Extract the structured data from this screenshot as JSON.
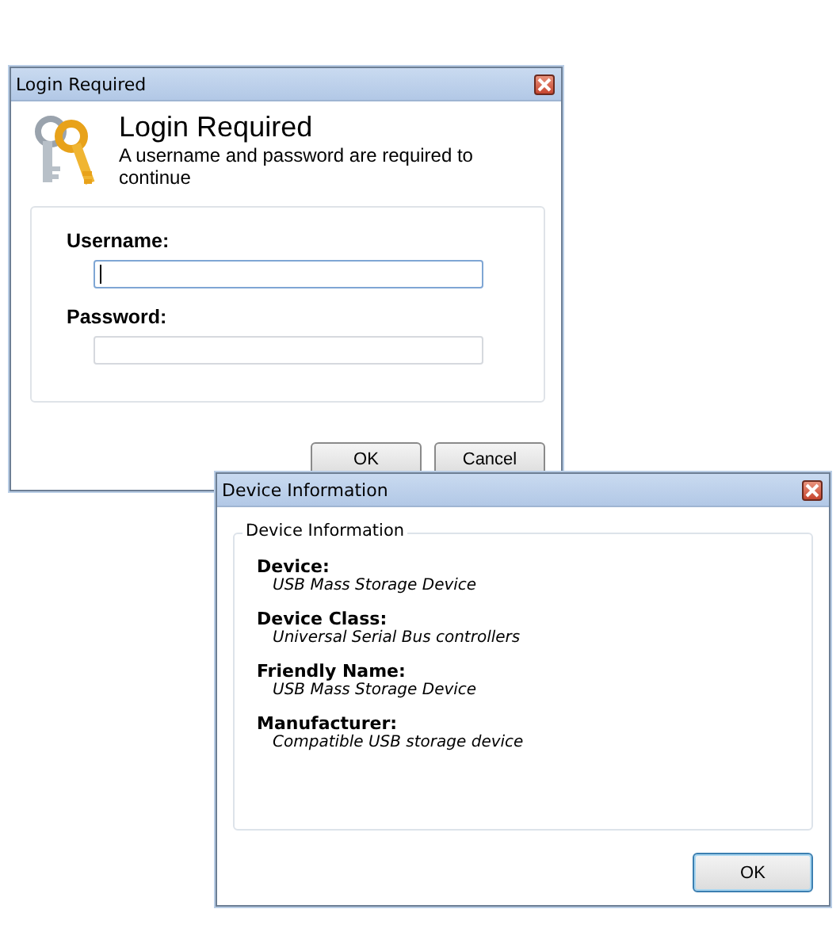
{
  "login_window": {
    "title": "Login Required",
    "heading": "Login Required",
    "message": "A username and password are required to continue",
    "fields": [
      {
        "label": "Username:",
        "focused": true
      },
      {
        "label": "Password:",
        "focused": false
      }
    ],
    "buttons": [
      {
        "label": "OK",
        "default": false
      },
      {
        "label": "Cancel",
        "default": false
      }
    ]
  },
  "device_window": {
    "title": "Device Information",
    "group_title": "Device Information",
    "properties": [
      {
        "label": "Device:",
        "value": "USB Mass Storage Device"
      },
      {
        "label": "Device Class:",
        "value": "Universal Serial Bus controllers"
      },
      {
        "label": "Friendly Name:",
        "value": "USB Mass Storage Device"
      },
      {
        "label": "Manufacturer:",
        "value": "Compatible USB storage device"
      }
    ],
    "buttons": [
      {
        "label": "OK",
        "default": true
      }
    ]
  }
}
